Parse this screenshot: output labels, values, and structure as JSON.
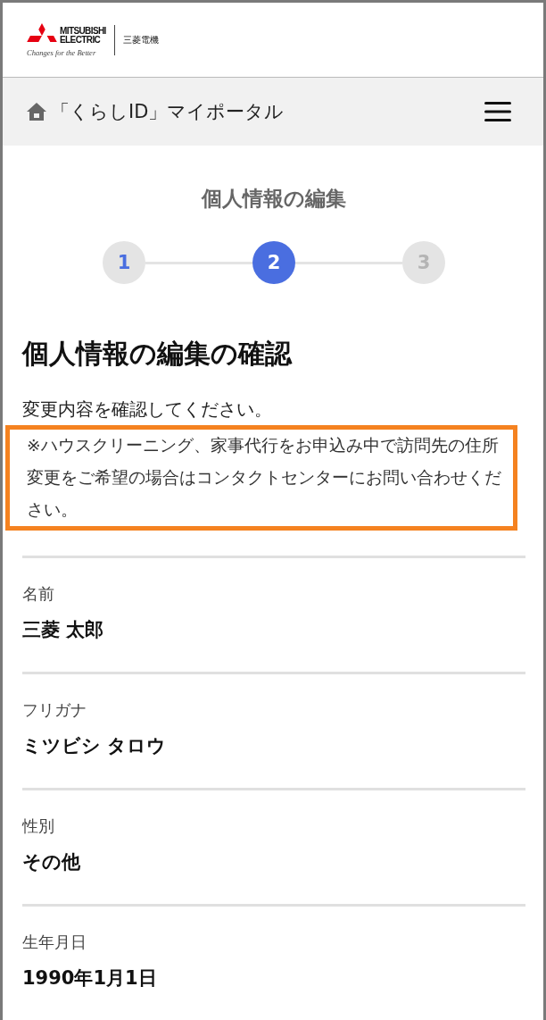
{
  "header": {
    "brand_line1": "MITSUBISHI",
    "brand_line2": "ELECTRIC",
    "tagline": "Changes for the Better",
    "brand_jp": "三菱電機"
  },
  "nav": {
    "title": "「くらしID」マイポータル"
  },
  "page_title": "個人情報の編集",
  "steps": [
    {
      "label": "1",
      "completed": true,
      "selected": false
    },
    {
      "label": "2",
      "completed": false,
      "selected": true
    },
    {
      "label": "3",
      "completed": false,
      "selected": false
    }
  ],
  "heading": "個人情報の編集の確認",
  "instruction": "変更内容を確認してください。",
  "note": {
    "text": "※ハウスクリーニング、家事代行をお申込み中で訪問先の住所変更をご希望の場合はコンタクトセンターにお問い合わせください。",
    "highlighted": true
  },
  "fields": [
    {
      "label": "名前",
      "value": "三菱 太郎"
    },
    {
      "label": "フリガナ",
      "value": "ミツビシ タロウ"
    },
    {
      "label": "性別",
      "value": "その他"
    },
    {
      "label": "生年月日",
      "value": "1990年1月1日"
    }
  ]
}
